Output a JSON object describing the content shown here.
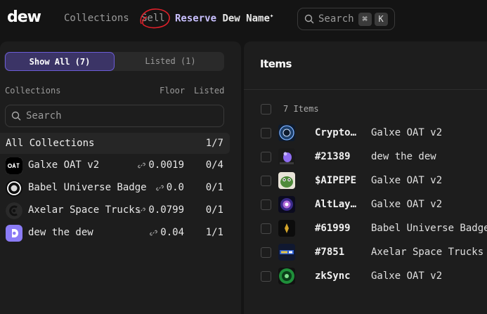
{
  "nav": {
    "logo": "dew",
    "collections": "Collections",
    "sell": "Sell",
    "reserve": "Reserve",
    "dew_name": "Dew Name",
    "reserve_mark": "✦",
    "search_placeholder": "Search",
    "shortcut_cmd": "⌘",
    "shortcut_key": "K"
  },
  "filters": {
    "show_all": "Show All (7)",
    "listed": "Listed (1)"
  },
  "collections_header": {
    "collections": "Collections",
    "floor": "Floor",
    "listed": "Listed"
  },
  "collection_search_placeholder": "Search",
  "all_collections": {
    "name": "All Collections",
    "count": "1/7"
  },
  "collections": [
    {
      "name": "Galxe OAT v2",
      "floor": "0.0019",
      "listed": "0/4",
      "icon": "oat-logo-icon"
    },
    {
      "name": "Babel Universe Badge",
      "floor": "0.0",
      "listed": "0/1",
      "icon": "babel-ring-icon"
    },
    {
      "name": "Axelar Space Trucks",
      "floor": "0.0799",
      "listed": "0/1",
      "icon": "axelar-icon"
    },
    {
      "name": "dew the dew",
      "floor": "0.04",
      "listed": "1/1",
      "icon": "dew-drop-icon"
    }
  ],
  "items_panel": {
    "title": "Items",
    "count": "7 Items"
  },
  "items": [
    {
      "name": "CryptoRank",
      "collection": "Galxe OAT v2"
    },
    {
      "name": "#21389",
      "collection": "dew the dew"
    },
    {
      "name": "$AIPEPE",
      "collection": "Galxe OAT v2"
    },
    {
      "name": "AltLayer",
      "collection": "Galxe OAT v2"
    },
    {
      "name": "#61999",
      "collection": "Babel Universe Badge"
    },
    {
      "name": "#7851",
      "collection": "Axelar Space Trucks"
    },
    {
      "name": "zkSync",
      "collection": "Galxe OAT v2"
    }
  ],
  "colors": {
    "accent": "#6b5cd6",
    "accent_bg": "#3b3466",
    "annotation": "#e0202a"
  }
}
